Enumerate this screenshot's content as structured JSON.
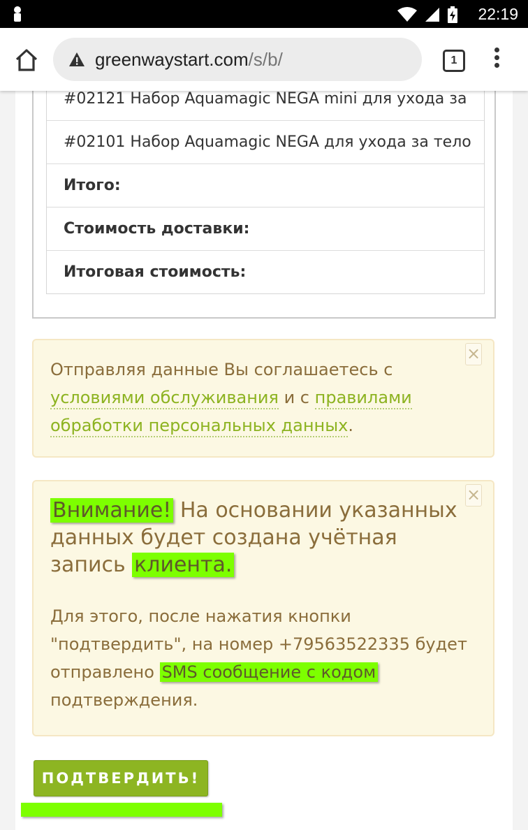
{
  "status_bar": {
    "time": "22:19",
    "icons": [
      "notification-icon",
      "wifi-icon",
      "signal-icon",
      "battery-charging-icon"
    ]
  },
  "browser": {
    "url_domain": "greenwaystart.com",
    "url_path": "/s/b/",
    "tab_count": "1",
    "icons": [
      "home-icon",
      "warning-icon",
      "tabs-icon",
      "menu-icon"
    ]
  },
  "order_table": {
    "rows": [
      "#02121 Набор Aquamagic NEGA mini для ухода за",
      "#02101 Набор Aquamagic NEGA для ухода за тело",
      "Итого:",
      "Стоимость доставки:",
      "Итоговая стоимость:"
    ]
  },
  "agreement_alert": {
    "text_before": "Отправляя данные Вы соглашаетесь с ",
    "link1": "условиями обслуживания",
    "text_middle": " и с ",
    "link2": "правилами обработки персональных данных",
    "text_after": ".",
    "close": "×"
  },
  "warning_alert": {
    "highlight1": "Внимание!",
    "headline_text": " На основании указанных данных будет создана учётная запись ",
    "highlight2": "клиента.",
    "body_text": "Для этого, после нажатия кнопки \"подтвердить\", на номер +79563522335 будет отправлено ",
    "highlight3": "SMS сообщение с кодом",
    "body_end": " подтверждения.",
    "close": "×"
  },
  "confirm_button": {
    "label": "ПОДТВЕРДИТЬ!"
  },
  "colors": {
    "accent": "#8db522",
    "highlight": "#7dff00",
    "alert_bg": "#fcf8e3",
    "alert_text": "#8a6d3b"
  }
}
